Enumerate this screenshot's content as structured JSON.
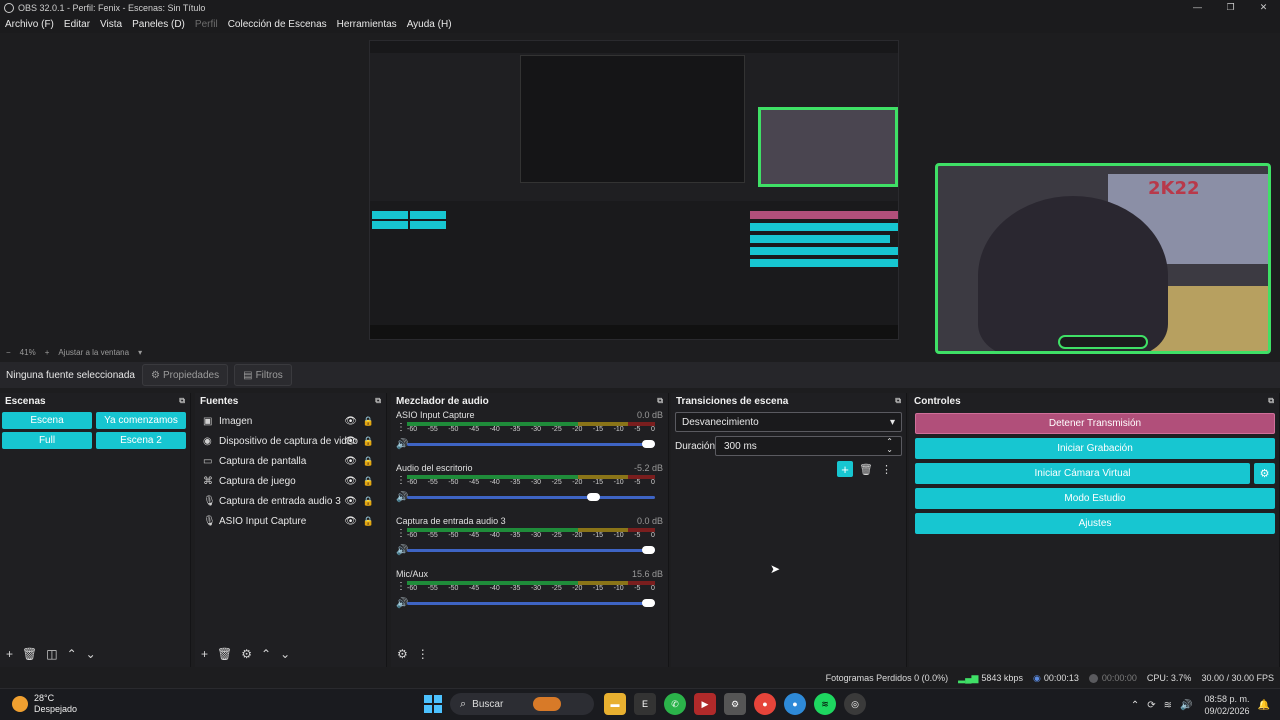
{
  "window": {
    "title": "OBS 32.0.1 - Perfil: Fenix - Escenas: Sin Título",
    "controls": [
      "minimize-icon",
      "maximize-icon",
      "close-icon"
    ]
  },
  "menu": [
    "Archivo (F)",
    "Editar",
    "Vista",
    "Paneles (D)",
    "Perfil",
    "Colección de Escenas",
    "Herramientas",
    "Ayuda (H)"
  ],
  "zoom": {
    "minus": "−",
    "value": "41%",
    "plus": "+",
    "fit_label": "Ajustar a la ventana"
  },
  "source_toolbar": {
    "no_source": "Ninguna fuente seleccionada",
    "properties": "Propiedades",
    "filters": "Filtros"
  },
  "scenes": {
    "title": "Escenas",
    "items": [
      "Escena",
      "Ya comenzamos",
      "Full",
      "Escena 2"
    ]
  },
  "sources": {
    "title": "Fuentes",
    "items": [
      {
        "name": "Imagen",
        "icon": "image-icon"
      },
      {
        "name": "Dispositivo de captura de video",
        "icon": "camera-icon"
      },
      {
        "name": "Captura de pantalla",
        "icon": "monitor-icon"
      },
      {
        "name": "Captura de juego",
        "icon": "gamepad-icon"
      },
      {
        "name": "Captura de entrada audio 3",
        "icon": "microphone-icon"
      },
      {
        "name": "ASIO Input Capture",
        "icon": "microphone-icon"
      }
    ]
  },
  "mixer": {
    "title": "Mezclador de audio",
    "ticks": [
      "-60",
      "-55",
      "-50",
      "-45",
      "-40",
      "-35",
      "-30",
      "-25",
      "-20",
      "-15",
      "-10",
      "-5",
      "0"
    ],
    "channels": [
      {
        "name": "ASIO Input Capture",
        "db": "0.0 dB",
        "volume": 1.0
      },
      {
        "name": "Audio del escritorio",
        "db": "-5.2 dB",
        "volume": 0.78
      },
      {
        "name": "Captura de entrada audio 3",
        "db": "0.0 dB",
        "volume": 1.0
      },
      {
        "name": "Mic/Aux",
        "db": "15.6 dB",
        "volume": 1.0
      }
    ]
  },
  "transitions": {
    "title": "Transiciones de escena",
    "selected": "Desvanecimiento",
    "duration_label": "Duración",
    "duration_value": "300 ms"
  },
  "controls": {
    "title": "Controles",
    "stop_stream": "Detener Transmisión",
    "start_recording": "Iniciar Grabación",
    "start_virtual_cam": "Iniciar Cámara Virtual",
    "studio_mode": "Modo Estudio",
    "settings": "Ajustes"
  },
  "status": {
    "dropped_frames": "Fotogramas Perdidos 0 (0.0%)",
    "bitrate": "5843 kbps",
    "stream_time": "00:00:13",
    "rec_time": "00:00:00",
    "cpu": "CPU: 3.7%",
    "fps": "30.00 / 30.00 FPS"
  },
  "taskbar": {
    "temperature": "28°C",
    "weather": "Despejado",
    "search": "Buscar",
    "time": "08:58 p. m.",
    "date": "09/02/2026",
    "apps": [
      "file-explorer-icon",
      "epic-games-icon",
      "whatsapp-icon",
      "video-app-icon",
      "settings-app-icon",
      "chrome-icon",
      "chrome-dev-icon",
      "spotify-icon",
      "obs-icon"
    ]
  },
  "overlay": {
    "brand": "2K22"
  },
  "colors": {
    "accent": "#17c6d1",
    "stop": "#b14f7a",
    "camera_frame": "#3fe066",
    "volume": "#3e64c4"
  }
}
